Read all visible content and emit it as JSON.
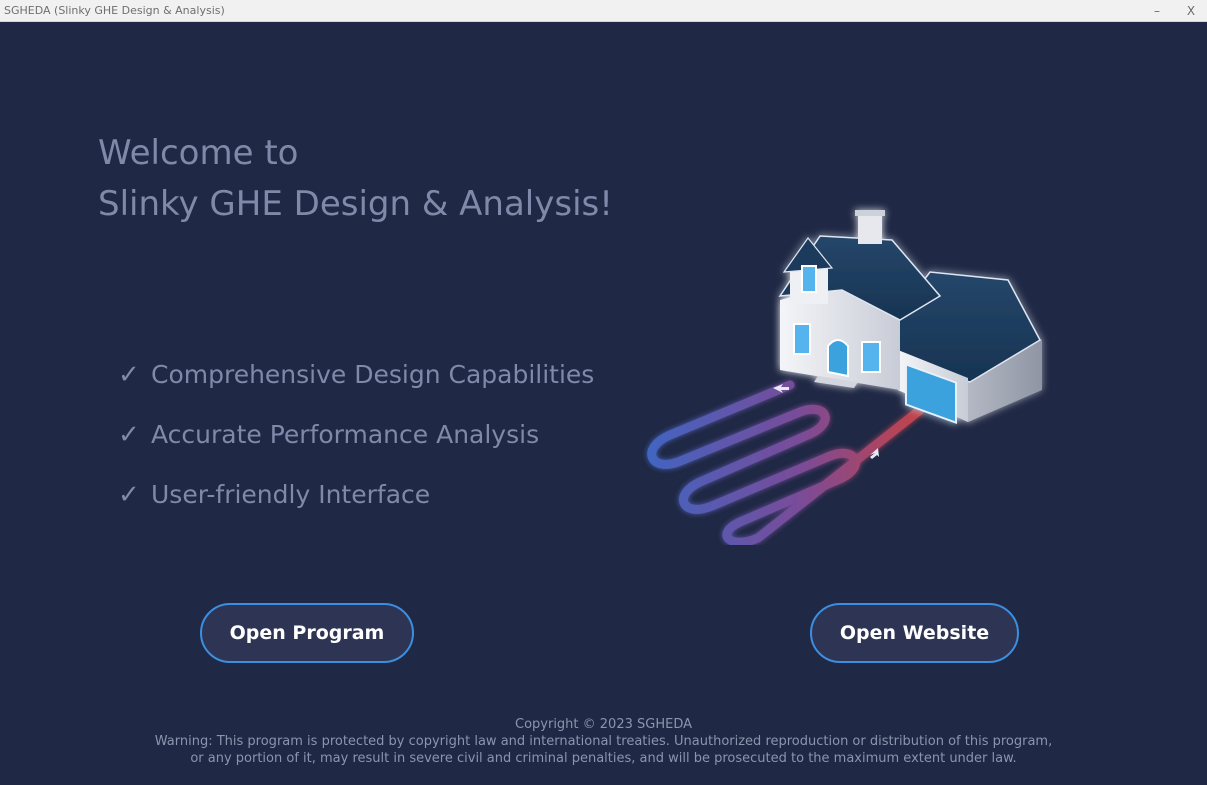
{
  "window": {
    "title": "SGHEDA (Slinky GHE Design & Analysis)",
    "minimize_glyph": "–",
    "close_glyph": "X"
  },
  "welcome": {
    "line1": "Welcome to",
    "line2": "Slinky GHE Design & Analysis!"
  },
  "features": {
    "check": "✓",
    "items": [
      "Comprehensive Design Capabilities",
      "Accurate Performance Analysis",
      "User-friendly Interface"
    ]
  },
  "buttons": {
    "open_program": "Open Program",
    "open_website": "Open Website"
  },
  "footer": {
    "copyright": "Copyright © 2023 SGHEDA",
    "warning_line1": "Warning: This program is protected by copyright law and international treaties. Unauthorized reproduction or distribution of this program,",
    "warning_line2": "or any portion of it, may result in severe civil and criminal penalties, and will be prosecuted to the maximum extent under law."
  },
  "colors": {
    "background": "#1f2844",
    "text_muted": "#7f89a9",
    "button_border": "#3b8ee0",
    "button_fill": "#2e3554",
    "pipe_cold": "#4a6fd6",
    "pipe_hot": "#e0484a"
  },
  "icons": {
    "illustration": "house-with-ground-heat-exchanger-illustration"
  }
}
